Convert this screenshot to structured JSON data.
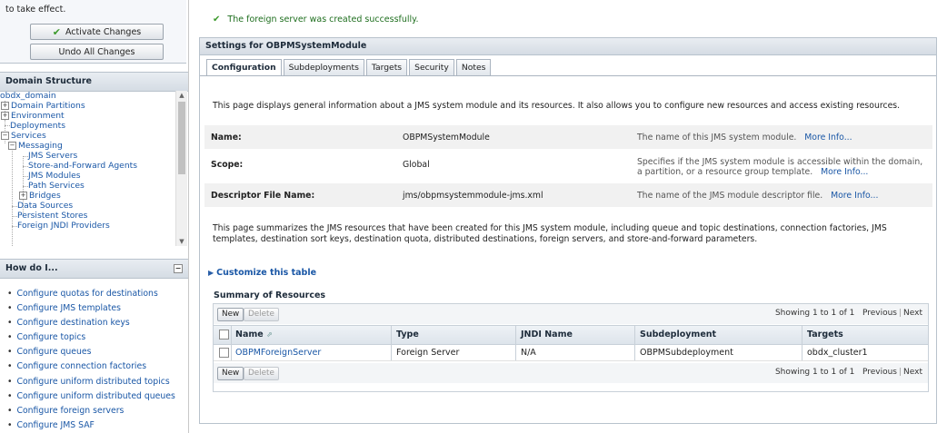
{
  "change_center": {
    "take_effect": "to take effect.",
    "activate_label": "Activate Changes",
    "undo_label": "Undo All Changes"
  },
  "domain_structure": {
    "title": "Domain Structure",
    "items": [
      "obdx_domain",
      "Domain Partitions",
      "Environment",
      "Deployments",
      "Services",
      "Messaging",
      "JMS Servers",
      "Store-and-Forward Agents",
      "JMS Modules",
      "Path Services",
      "Bridges",
      "Data Sources",
      "Persistent Stores",
      "Foreign JNDI Providers"
    ]
  },
  "how_do_i": {
    "title": "How do I...",
    "items": [
      "Configure quotas for destinations",
      "Configure JMS templates",
      "Configure destination keys",
      "Configure topics",
      "Configure queues",
      "Configure connection factories",
      "Configure uniform distributed topics",
      "Configure uniform distributed queues",
      "Configure foreign servers",
      "Configure JMS SAF"
    ]
  },
  "message": "The foreign server was created successfully.",
  "settings": {
    "title": "Settings for OBPMSystemModule",
    "tabs": [
      "Configuration",
      "Subdeployments",
      "Targets",
      "Security",
      "Notes"
    ],
    "intro": "This page displays general information about a JMS system module and its resources. It also allows you to configure new resources and access existing resources.",
    "fields": [
      {
        "label": "Name:",
        "value": "OBPMSystemModule",
        "desc": "The name of this JMS system module.",
        "more": "More Info..."
      },
      {
        "label": "Scope:",
        "value": "Global",
        "desc": "Specifies if the JMS system module is accessible within the domain, a partition, or a resource group template.",
        "more": "More Info..."
      },
      {
        "label": "Descriptor File Name:",
        "value": "jms/obpmsystemmodule-jms.xml",
        "desc": "The name of the JMS module descriptor file.",
        "more": "More Info..."
      }
    ],
    "summary_text": "This page summarizes the JMS resources that have been created for this JMS system module, including queue and topic destinations, connection factories, JMS templates, destination sort keys, destination quota, distributed destinations, foreign servers, and store-and-forward parameters.",
    "customize": "Customize this table",
    "summary_title": "Summary of Resources",
    "new_label": "New",
    "delete_label": "Delete",
    "paging": {
      "showing": "Showing 1 to 1 of 1",
      "previous": "Previous",
      "next": "Next"
    },
    "columns": [
      "Name",
      "Type",
      "JNDI Name",
      "Subdeployment",
      "Targets"
    ],
    "rows": [
      {
        "name": "OBPMForeignServer",
        "type": "Foreign Server",
        "jndi": "N/A",
        "subdeployment": "OBPMSubdeployment",
        "targets": "obdx_cluster1"
      }
    ]
  },
  "colors": {
    "link": "#1a57a6",
    "success": "#3c9a2c",
    "panel_header": "#d5dce4"
  }
}
